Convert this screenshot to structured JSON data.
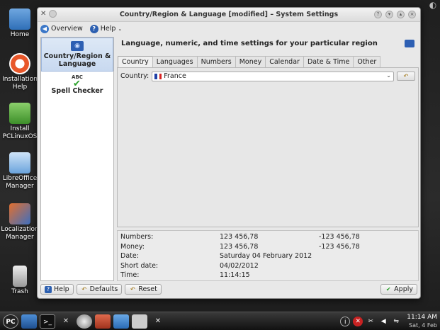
{
  "desktop": {
    "icons": [
      {
        "label": "Home"
      },
      {
        "label": "Installation Help"
      },
      {
        "label": "Install PCLinuxOS"
      },
      {
        "label": "LibreOffice Manager"
      },
      {
        "label": "Localization Manager"
      },
      {
        "label": "Trash"
      }
    ]
  },
  "window": {
    "title": "Country/Region & Language [modified] – System Settings",
    "toolbar": {
      "overview_label": "Overview",
      "help_label": "Help"
    },
    "sidebar": {
      "items": [
        {
          "label": "Country/Region & Language"
        },
        {
          "label": "Spell Checker"
        }
      ]
    },
    "heading": "Language, numeric, and time settings for your particular region",
    "tabs": [
      {
        "label": "Country"
      },
      {
        "label": "Languages"
      },
      {
        "label": "Numbers"
      },
      {
        "label": "Money"
      },
      {
        "label": "Calendar"
      },
      {
        "label": "Date & Time"
      },
      {
        "label": "Other"
      }
    ],
    "country": {
      "label": "Country:",
      "value": "France"
    },
    "examples": [
      {
        "label": "Numbers:",
        "v1": "123 456,78",
        "v2": "-123 456,78"
      },
      {
        "label": "Money:",
        "v1": "123 456,78",
        "v2": "-123 456,78"
      },
      {
        "label": "Date:",
        "v1": "Saturday 04 February 2012",
        "v2": ""
      },
      {
        "label": "Short date:",
        "v1": "04/02/2012",
        "v2": ""
      },
      {
        "label": "Time:",
        "v1": "11:14:15",
        "v2": ""
      }
    ],
    "buttons": {
      "help": "Help",
      "defaults": "Defaults",
      "reset": "Reset",
      "apply": "Apply"
    }
  },
  "taskbar": {
    "start_label": "PC",
    "clock_time": "11:14 AM",
    "clock_date": "Sat, 4 Feb"
  },
  "colors": {
    "accent": "#2d5fb3",
    "france_blue": "#1f3fa6",
    "france_red": "#d82323"
  }
}
